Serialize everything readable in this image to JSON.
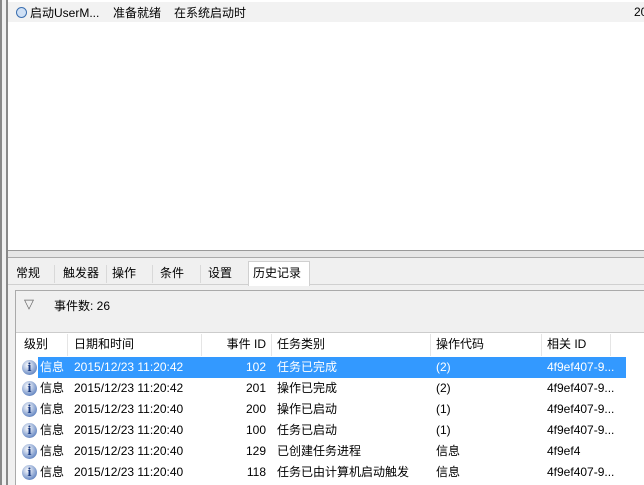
{
  "top_task": {
    "name": "启动UserM...",
    "status": "准备就绪",
    "trigger": "在系统启动时",
    "next": "20"
  },
  "tabs": [
    "常规",
    "触发器",
    "操作",
    "条件",
    "设置",
    "历史记录"
  ],
  "active_tab": "历史记录",
  "filter": {
    "icon": "filter-icon",
    "count_label": "事件数: 26"
  },
  "columns": [
    "级别",
    "日期和时间",
    "事件 ID",
    "任务类别",
    "操作代码",
    "相关 ID"
  ],
  "rows": [
    {
      "level": "信息",
      "date": "2015/12/23 11:20:42",
      "id": "102",
      "category": "任务已完成",
      "opcode": "(2)",
      "related": "4f9ef407-9...",
      "selected": true
    },
    {
      "level": "信息",
      "date": "2015/12/23 11:20:42",
      "id": "201",
      "category": "操作已完成",
      "opcode": "(2)",
      "related": "4f9ef407-9..."
    },
    {
      "level": "信息",
      "date": "2015/12/23 11:20:40",
      "id": "200",
      "category": "操作已启动",
      "opcode": "(1)",
      "related": "4f9ef407-9..."
    },
    {
      "level": "信息",
      "date": "2015/12/23 11:20:40",
      "id": "100",
      "category": "任务已启动",
      "opcode": "(1)",
      "related": "4f9ef407-9..."
    },
    {
      "level": "信息",
      "date": "2015/12/23 11:20:40",
      "id": "129",
      "category": "已创建任务进程",
      "opcode": "信息",
      "related": "4f9ef4"
    },
    {
      "level": "信息",
      "date": "2015/12/23 11:20:40",
      "id": "118",
      "category": "任务已由计算机启动触发",
      "opcode": "信息",
      "related": "4f9ef407-9..."
    }
  ],
  "colors": {
    "selection": "#3399ff"
  }
}
